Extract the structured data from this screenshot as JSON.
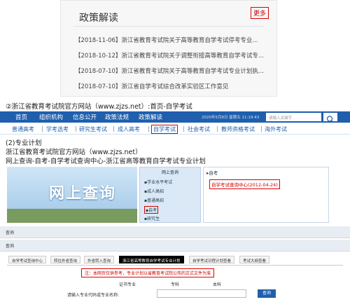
{
  "policy": {
    "title": "政策解读",
    "more": "更多",
    "items": [
      "【2018-11-06】浙江省教育考试院关于高等教育自学考试停考专业...",
      "【2018-10-12】浙江省教育考试院关于调整衔接高等教育自学考试专...",
      "【2018-07-10】浙江省教育考试院关于高等教育自学考试专业计划执...",
      "【2018-07-10】浙江省自学考试综合改革实验区工作意见"
    ]
  },
  "captions": {
    "c1": "②浙江省教育考试院官方网站（www.zjzs.net）:首页-自学考试",
    "c2": "(2)专业计划",
    "c3": "浙江省教育考试院官方网站（www.zjzs.net）",
    "c4": "网上查询-自考-自学考试查询中心-浙江省高等教育自学考试专业计划"
  },
  "nav1": {
    "items": [
      "首页",
      "组织机构",
      "信息公开",
      "政策法规",
      "政策解读"
    ],
    "date": "2020年5月8日 星期五 11:19:43",
    "search_placeholder": "请输入关键字"
  },
  "nav2": {
    "items": [
      "普通高考",
      "学考选考",
      "研究生考试",
      "成人高考",
      "自学考试",
      "社会考试",
      "教师资格考试",
      "海外考试"
    ]
  },
  "query": {
    "banner_text": "网上查询",
    "menu_head": "网上查询",
    "menu": [
      "学业水平考试",
      "成人高招",
      "普通高招",
      "自考",
      "研究生"
    ],
    "panel_head": "自考",
    "panel_link": "自学考试查询中心(2012-04-24)"
  },
  "crumbs": [
    "查询",
    "查询"
  ],
  "tabs": [
    "自学考试查询中心",
    "转往外省查询",
    "外省转入查询",
    "浙江省高等教育自学考试专业计划",
    "自学考试日程计划查看",
    "考试大纲查看"
  ],
  "note": "注：本网页仅供参考，专业计划以省教育考试院公布的正式文件为准",
  "form": {
    "labels": [
      "证书专业",
      "专科",
      "本科"
    ],
    "input_label": "请输入专业代码或专业名称:",
    "button": "查询"
  },
  "colors": {
    "nav_blue": "#1f5fae",
    "highlight_red": "#dd0000"
  }
}
